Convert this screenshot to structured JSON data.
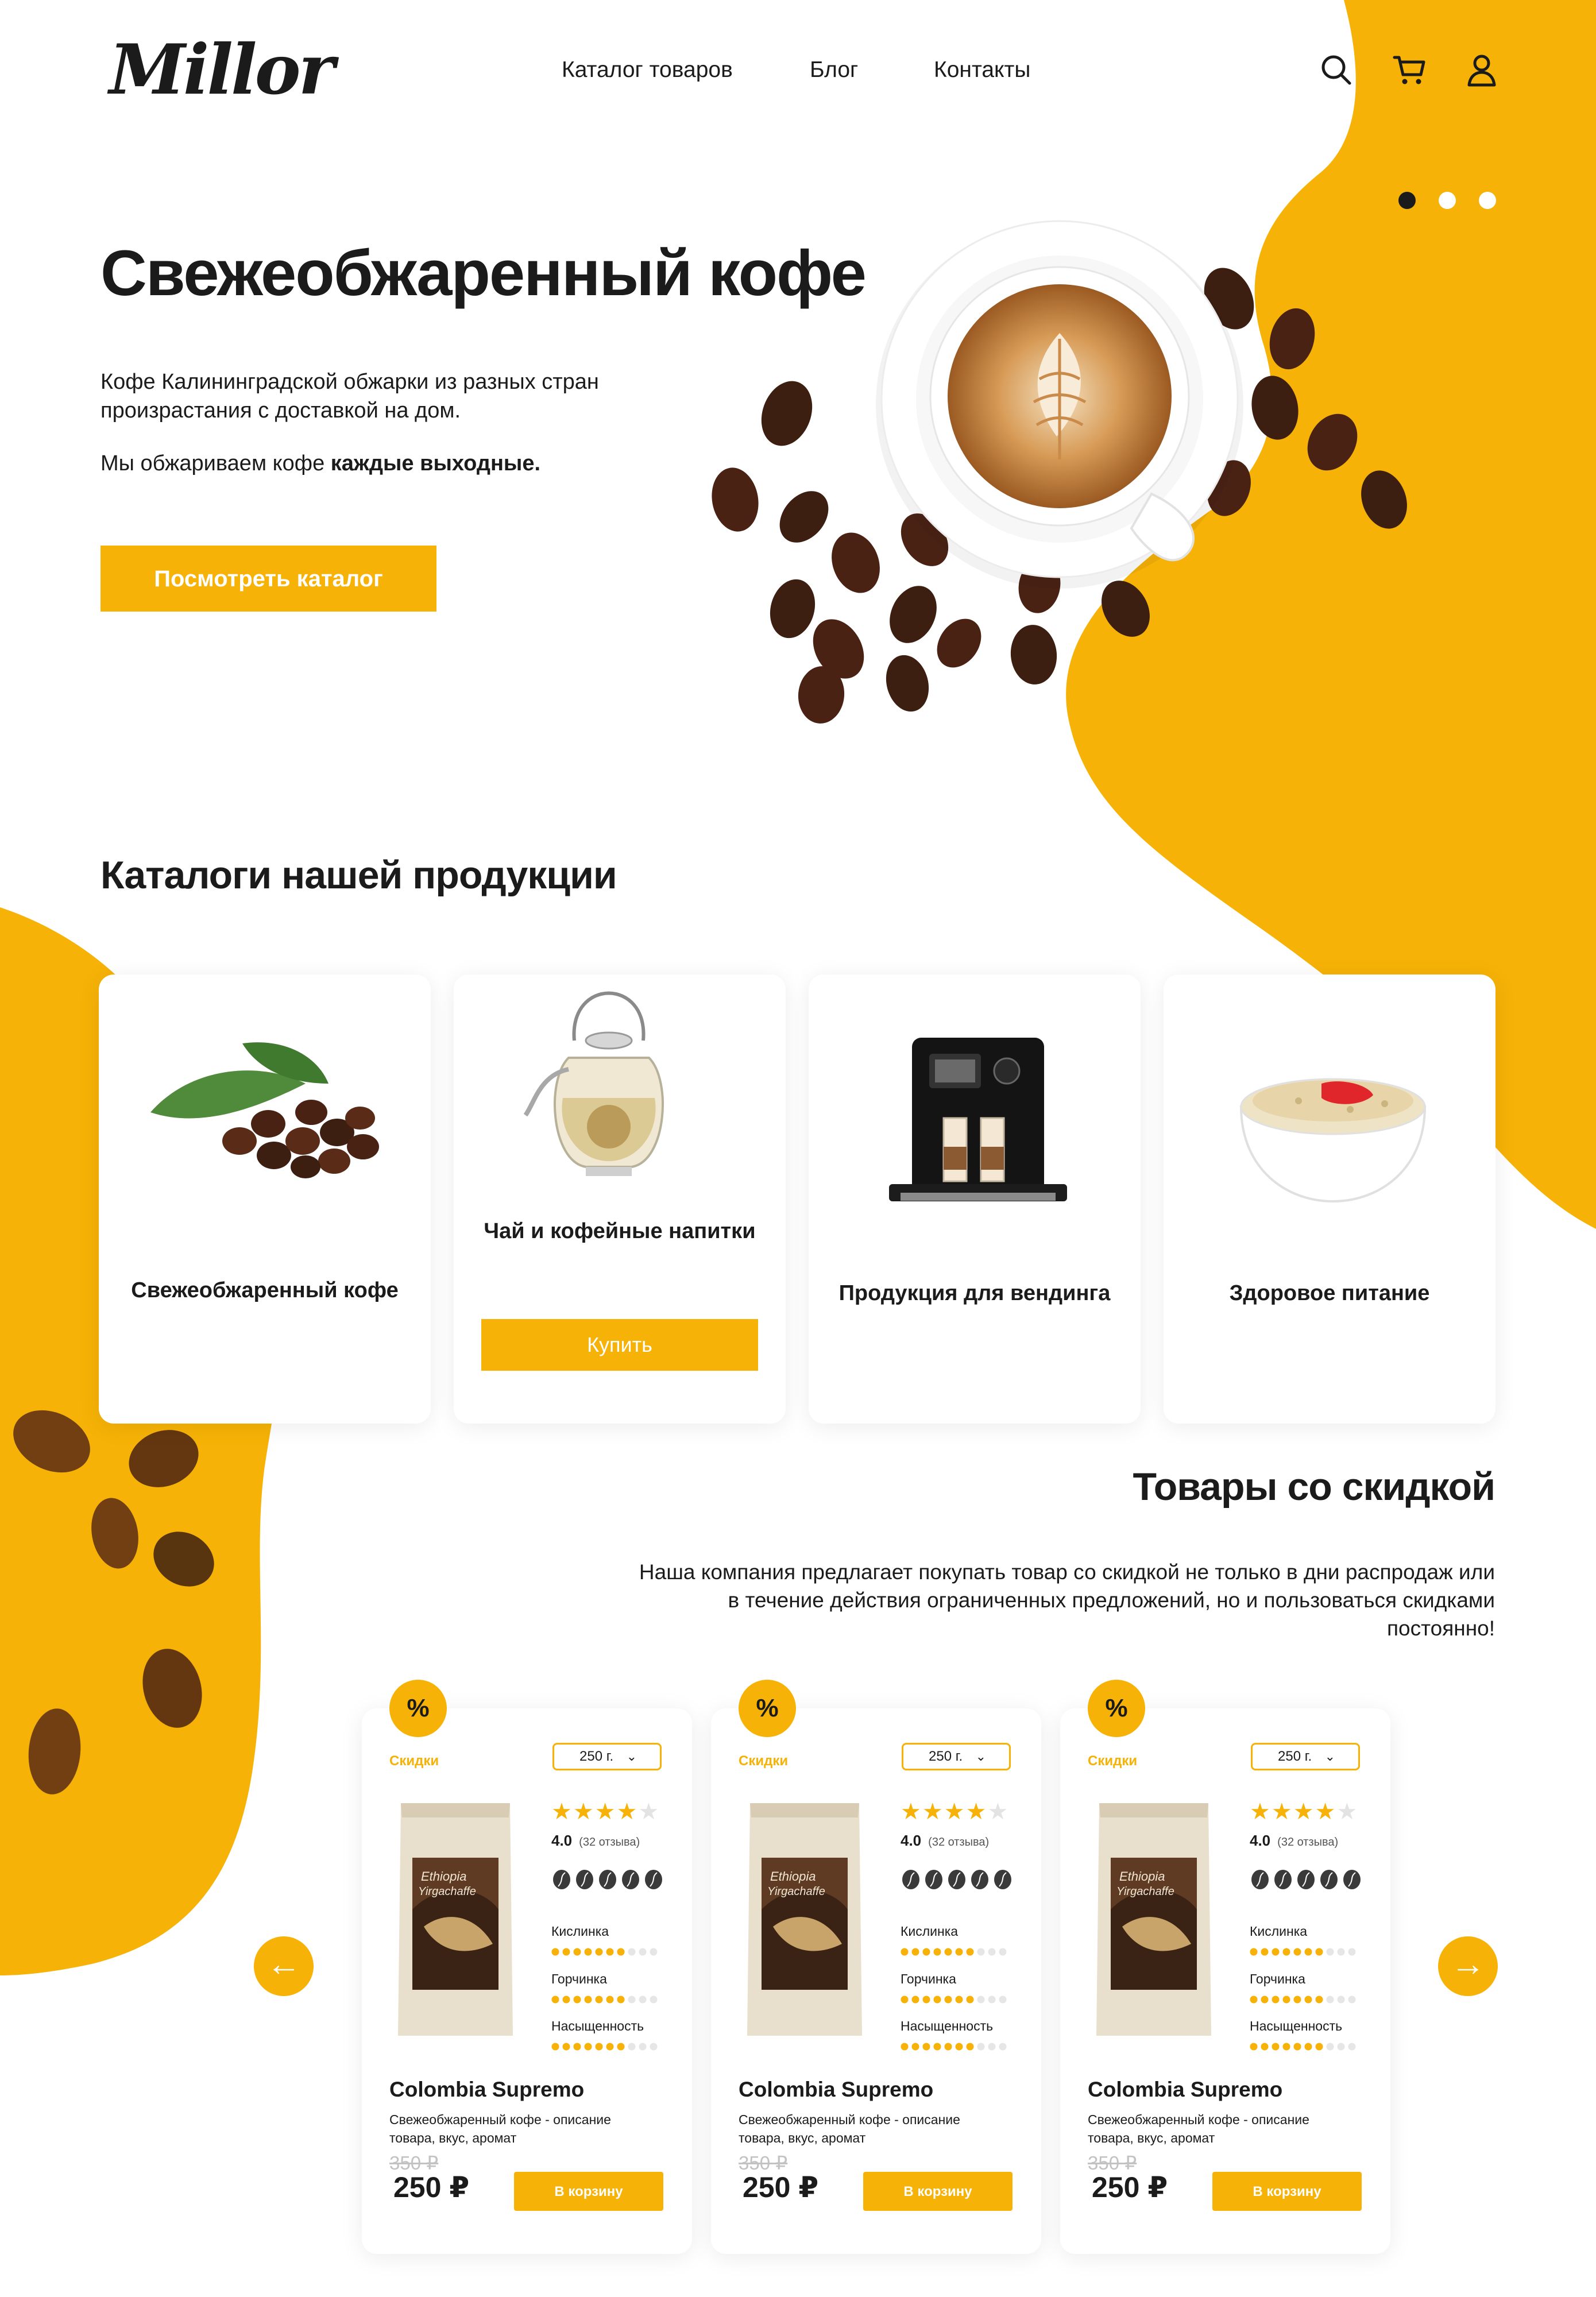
{
  "header": {
    "logo": "Millor",
    "nav": [
      "Каталог товаров",
      "Блог",
      "Контакты"
    ],
    "icons": [
      "search-icon",
      "cart-icon",
      "user-icon"
    ]
  },
  "hero": {
    "title": "Свежеобжаренный кофе",
    "text1": "Кофе Калининградской обжарки из разных стран произрастания с доставкой на дом.",
    "text2_plain": "Мы обжариваем кофе ",
    "text2_bold": "каждые выходные.",
    "button": "Посмотреть каталог",
    "slider_dots": 3,
    "slider_active": 1
  },
  "catalog": {
    "title": "Каталоги нашей продукции",
    "cards": [
      {
        "label": "Свежеобжаренный кофе",
        "image": "coffee-beans-image"
      },
      {
        "label": "Чай и кофейные напитки",
        "image": "teapot-image",
        "button": "Купить"
      },
      {
        "label": "Продукция для вендинга",
        "image": "coffee-machine-image"
      },
      {
        "label": "Здоровое питание",
        "image": "porridge-image"
      }
    ]
  },
  "promo": {
    "title": "Товары со скидкой",
    "text": "Наша компания предлагает покупать товар со скидкой не только в дни распродаж или в течение действия ограниченных предложений, но и пользоваться скидками постоянно!",
    "products": [
      {
        "badge": "%",
        "tag": "Скидки",
        "weight": "250 г.",
        "bag_line1": "Ethiopia",
        "bag_line2": "Yirgachaffe",
        "rating": 4.0,
        "rating_value": "4.0",
        "reviews": "(32 отзыва)",
        "roast": 5,
        "metrics": [
          {
            "label": "Кислинка",
            "value": 7
          },
          {
            "label": "Горчинка",
            "value": 7
          },
          {
            "label": "Насыщенность",
            "value": 7
          }
        ],
        "name": "Colombia Supremo",
        "desc": "Свежеобжаренный кофе - описание товара, вкус, аромат",
        "old_price": "350 ₽",
        "price": "250 ₽",
        "button": "В корзину"
      },
      {
        "badge": "%",
        "tag": "Скидки",
        "weight": "250 г.",
        "bag_line1": "Ethiopia",
        "bag_line2": "Yirgachaffe",
        "rating": 4.0,
        "rating_value": "4.0",
        "reviews": "(32 отзыва)",
        "roast": 5,
        "metrics": [
          {
            "label": "Кислинка",
            "value": 7
          },
          {
            "label": "Горчинка",
            "value": 7
          },
          {
            "label": "Насыщенность",
            "value": 7
          }
        ],
        "name": "Colombia Supremo",
        "desc": "Свежеобжаренный кофе - описание товара, вкус, аромат",
        "old_price": "350 ₽",
        "price": "250 ₽",
        "button": "В корзину"
      },
      {
        "badge": "%",
        "tag": "Скидки",
        "weight": "250 г.",
        "bag_line1": "Ethiopia",
        "bag_line2": "Yirgachaffe",
        "rating": 4.0,
        "rating_value": "4.0",
        "reviews": "(32 отзыва)",
        "roast": 5,
        "metrics": [
          {
            "label": "Кислинка",
            "value": 7
          },
          {
            "label": "Горчинка",
            "value": 7
          },
          {
            "label": "Насыщенность",
            "value": 7
          }
        ],
        "name": "Colombia Supremo",
        "desc": "Свежеобжаренный кофе - описание товара, вкус, аромат",
        "old_price": "350 ₽",
        "price": "250 ₽",
        "button": "В корзину"
      }
    ],
    "prev_arrow": "←",
    "next_arrow": "→"
  },
  "colors": {
    "accent": "#f6b206",
    "text": "#1b1b1b",
    "bean": "#3d1f12",
    "muted": "#e3e3e3"
  }
}
